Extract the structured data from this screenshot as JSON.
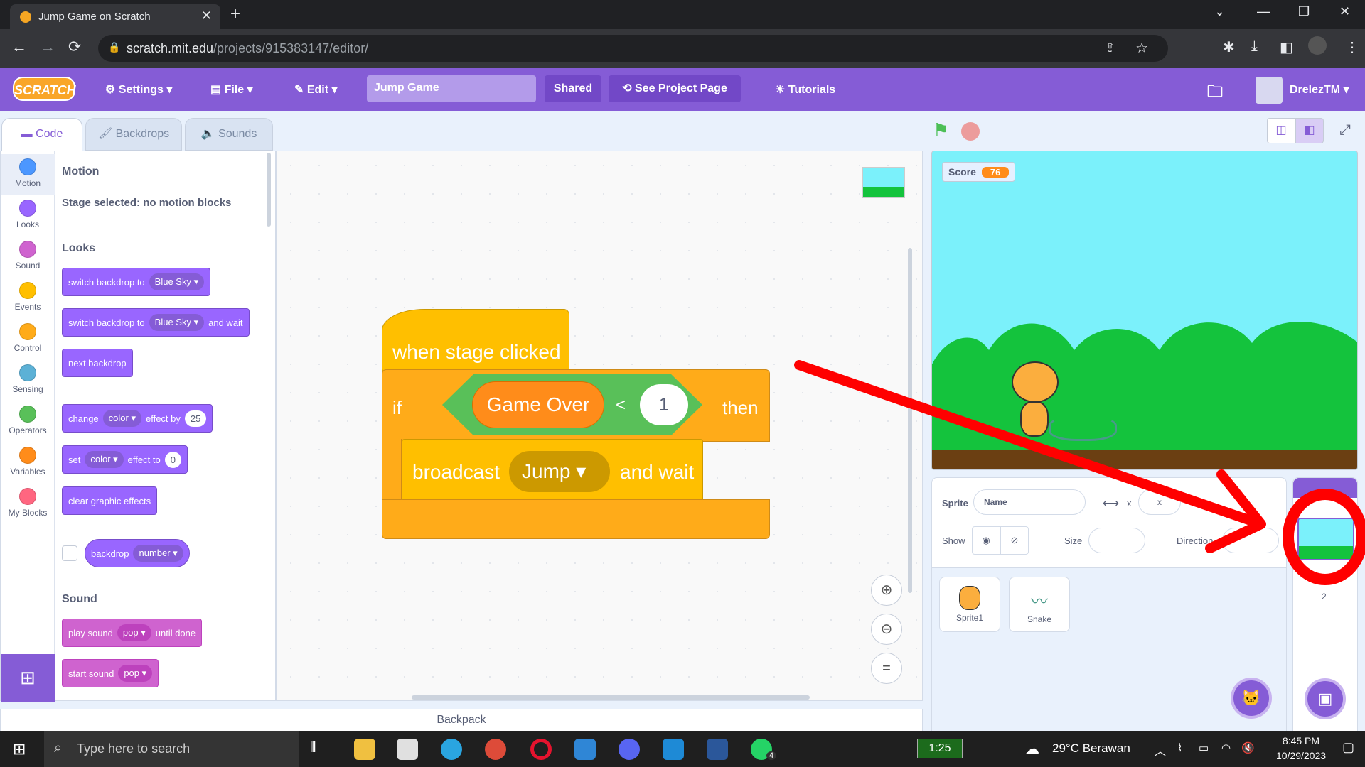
{
  "browser": {
    "tab_title": "Jump Game on Scratch",
    "url_host": "scratch.mit.edu",
    "url_path": "/projects/915383147/editor/"
  },
  "menu": {
    "logo": "SCRATCH",
    "settings": "Settings",
    "file": "File",
    "edit": "Edit",
    "project_title": "Jump Game",
    "shared": "Shared",
    "see_project": "See Project Page",
    "tutorials": "Tutorials",
    "user": "DrelezTM"
  },
  "editor_tabs": {
    "code": "Code",
    "backdrops": "Backdrops",
    "sounds": "Sounds"
  },
  "categories": [
    {
      "label": "Motion",
      "color": "#4c97ff"
    },
    {
      "label": "Looks",
      "color": "#9966ff"
    },
    {
      "label": "Sound",
      "color": "#cf63cf"
    },
    {
      "label": "Events",
      "color": "#ffbf00"
    },
    {
      "label": "Control",
      "color": "#ffab19"
    },
    {
      "label": "Sensing",
      "color": "#5cb1d6"
    },
    {
      "label": "Operators",
      "color": "#59c059"
    },
    {
      "label": "Variables",
      "color": "#ff8c1a"
    },
    {
      "label": "My Blocks",
      "color": "#ff6680"
    }
  ],
  "palette": {
    "motion_header": "Motion",
    "motion_note": "Stage selected: no motion blocks",
    "looks_header": "Looks",
    "sound_header": "Sound",
    "switch_backdrop": "switch backdrop to",
    "blue_sky": "Blue Sky",
    "and_wait": "and wait",
    "next_backdrop": "next backdrop",
    "change": "change",
    "color": "color",
    "effect_by": "effect by",
    "effect_by_val": "25",
    "set": "set",
    "effect_to": "effect to",
    "effect_to_val": "0",
    "clear_effects": "clear graphic effects",
    "backdrop": "backdrop",
    "number": "number",
    "play_sound": "play sound",
    "pop": "pop",
    "until_done": "until done",
    "start_sound": "start sound"
  },
  "script": {
    "hat": "when stage clicked",
    "if": "if",
    "variable": "Game Over",
    "operator": "<",
    "value": "1",
    "then": "then",
    "broadcast": "broadcast",
    "message": "Jump",
    "and_wait": "and wait"
  },
  "stage": {
    "score_label": "Score",
    "score_value": "76"
  },
  "sprite_info": {
    "sprite_label": "Sprite",
    "name_placeholder": "Name",
    "x_label": "x",
    "x_placeholder": "x",
    "show_label": "Show",
    "size_label": "Size",
    "direction_label": "Direction"
  },
  "sprites": [
    {
      "name": "Sprite1"
    },
    {
      "name": "Snake"
    }
  ],
  "stage_pane": {
    "backdrop_count": "2"
  },
  "backpack": "Backpack",
  "taskbar": {
    "search": "Type here to search",
    "timer": "1:25",
    "weather": "29°C Berawan",
    "time": "8:45 PM",
    "date": "10/29/2023",
    "whatsapp_badge": "4"
  }
}
